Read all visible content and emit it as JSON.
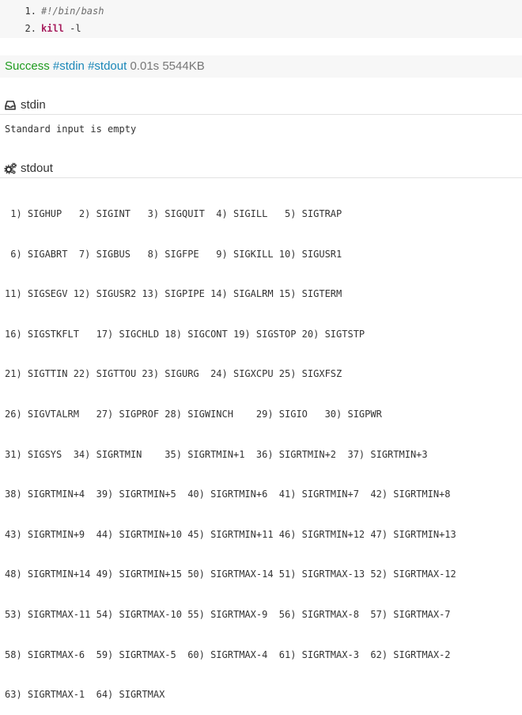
{
  "code": {
    "lines": [
      {
        "num": "1.",
        "text": "#!/bin/bash"
      },
      {
        "num": "2.",
        "keyword": "kill",
        "args": " -l"
      }
    ]
  },
  "status": {
    "result": "Success",
    "tag_stdin": "#stdin",
    "tag_stdout": "#stdout",
    "time": "0.01s",
    "memory": "5544KB"
  },
  "stdin": {
    "title": "stdin",
    "icon": "inbox-icon",
    "content": "Standard input is empty"
  },
  "stdout": {
    "title": "stdout",
    "icon": "gears-icon",
    "lines": [
      " 1) SIGHUP   2) SIGINT   3) SIGQUIT  4) SIGILL   5) SIGTRAP",
      " 6) SIGABRT  7) SIGBUS   8) SIGFPE   9) SIGKILL 10) SIGUSR1",
      "11) SIGSEGV 12) SIGUSR2 13) SIGPIPE 14) SIGALRM 15) SIGTERM",
      "16) SIGSTKFLT   17) SIGCHLD 18) SIGCONT 19) SIGSTOP 20) SIGTSTP",
      "21) SIGTTIN 22) SIGTTOU 23) SIGURG  24) SIGXCPU 25) SIGXFSZ",
      "26) SIGVTALRM   27) SIGPROF 28) SIGWINCH    29) SIGIO   30) SIGPWR",
      "31) SIGSYS  34) SIGRTMIN    35) SIGRTMIN+1  36) SIGRTMIN+2  37) SIGRTMIN+3",
      "38) SIGRTMIN+4  39) SIGRTMIN+5  40) SIGRTMIN+6  41) SIGRTMIN+7  42) SIGRTMIN+8",
      "43) SIGRTMIN+9  44) SIGRTMIN+10 45) SIGRTMIN+11 46) SIGRTMIN+12 47) SIGRTMIN+13",
      "48) SIGRTMIN+14 49) SIGRTMIN+15 50) SIGRTMAX-14 51) SIGRTMAX-13 52) SIGRTMAX-12",
      "53) SIGRTMAX-11 54) SIGRTMAX-10 55) SIGRTMAX-9  56) SIGRTMAX-8  57) SIGRTMAX-7",
      "58) SIGRTMAX-6  59) SIGRTMAX-5  60) SIGRTMAX-4  61) SIGRTMAX-3  62) SIGRTMAX-2",
      "63) SIGRTMAX-1  64) SIGRTMAX"
    ]
  }
}
